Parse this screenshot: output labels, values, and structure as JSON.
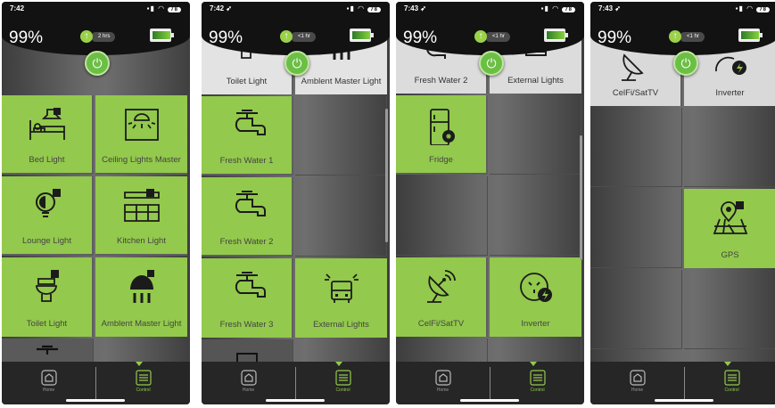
{
  "accent_color": "#93c94c",
  "screens": [
    {
      "status": {
        "time": "7:42",
        "battery_badge": "78"
      },
      "header": {
        "battery_percent": "99%",
        "charge_time": "2 hrs"
      },
      "tiles": [
        {
          "label": "Bed Light",
          "icon": "bed-light-icon",
          "state": "on"
        },
        {
          "label": "Ceiling Lights Master",
          "icon": "ceiling-light-icon",
          "state": "on"
        },
        {
          "label": "Lounge Light",
          "icon": "lounge-lamp-icon",
          "state": "on"
        },
        {
          "label": "Kitchen Light",
          "icon": "kitchen-icon",
          "state": "on"
        },
        {
          "label": "Toilet Light",
          "icon": "toilet-icon",
          "state": "on"
        },
        {
          "label": "Amblent Master Light",
          "icon": "ambient-lamp-icon",
          "state": "on"
        }
      ],
      "nav": {
        "home": "Home",
        "control": "Control"
      }
    },
    {
      "status": {
        "time": "7:42 ➶",
        "battery_badge": "78"
      },
      "header": {
        "battery_percent": "99%",
        "charge_time": "<1 hr"
      },
      "tiles": [
        {
          "label": "Toilet Light",
          "icon": "toilet-icon",
          "state": "dark"
        },
        {
          "label": "Amblent Master Light",
          "icon": "ambient-lamp-icon",
          "state": "dark"
        },
        {
          "label": "Fresh Water 1",
          "icon": "water-tap-icon",
          "state": "on"
        },
        {
          "label": "",
          "icon": "",
          "state": "off"
        },
        {
          "label": "Fresh Water 2",
          "icon": "water-tap-icon",
          "state": "on"
        },
        {
          "label": "",
          "icon": "",
          "state": "off"
        },
        {
          "label": "Fresh Water 3",
          "icon": "water-tap-icon",
          "state": "on"
        },
        {
          "label": "External Lights",
          "icon": "external-lights-icon",
          "state": "on"
        }
      ],
      "nav": {
        "home": "Home",
        "control": "Control"
      }
    },
    {
      "status": {
        "time": "7:43 ➶",
        "battery_badge": "78"
      },
      "header": {
        "battery_percent": "99%",
        "charge_time": "<1 hr"
      },
      "tiles": [
        {
          "label": "Fresh Water 2",
          "icon": "water-tap-icon",
          "state": "dark"
        },
        {
          "label": "External Lights",
          "icon": "external-lights-icon",
          "state": "dark"
        },
        {
          "label": "Fridge",
          "icon": "fridge-icon",
          "state": "on"
        },
        {
          "label": "",
          "icon": "",
          "state": "off"
        },
        {
          "label": "",
          "icon": "",
          "state": "off"
        },
        {
          "label": "",
          "icon": "",
          "state": "off"
        },
        {
          "label": "CelFi/SatTV",
          "icon": "satellite-dish-icon",
          "state": "on"
        },
        {
          "label": "Inverter",
          "icon": "inverter-outlet-icon",
          "state": "on"
        }
      ],
      "nav": {
        "home": "Home",
        "control": "Control"
      }
    },
    {
      "status": {
        "time": "7:43 ➶",
        "battery_badge": "78"
      },
      "header": {
        "battery_percent": "99%",
        "charge_time": "<1 hr"
      },
      "tiles": [
        {
          "label": "CelFi/SatTV",
          "icon": "satellite-dish-icon",
          "state": "dark"
        },
        {
          "label": "Inverter",
          "icon": "inverter-outlet-icon",
          "state": "dark"
        },
        {
          "label": "",
          "icon": "",
          "state": "off"
        },
        {
          "label": "",
          "icon": "",
          "state": "off"
        },
        {
          "label": "",
          "icon": "",
          "state": "off"
        },
        {
          "label": "GPS",
          "icon": "gps-map-icon",
          "state": "on"
        },
        {
          "label": "",
          "icon": "",
          "state": "off"
        },
        {
          "label": "",
          "icon": "",
          "state": "off"
        }
      ],
      "nav": {
        "home": "Home",
        "control": "Control"
      }
    }
  ]
}
